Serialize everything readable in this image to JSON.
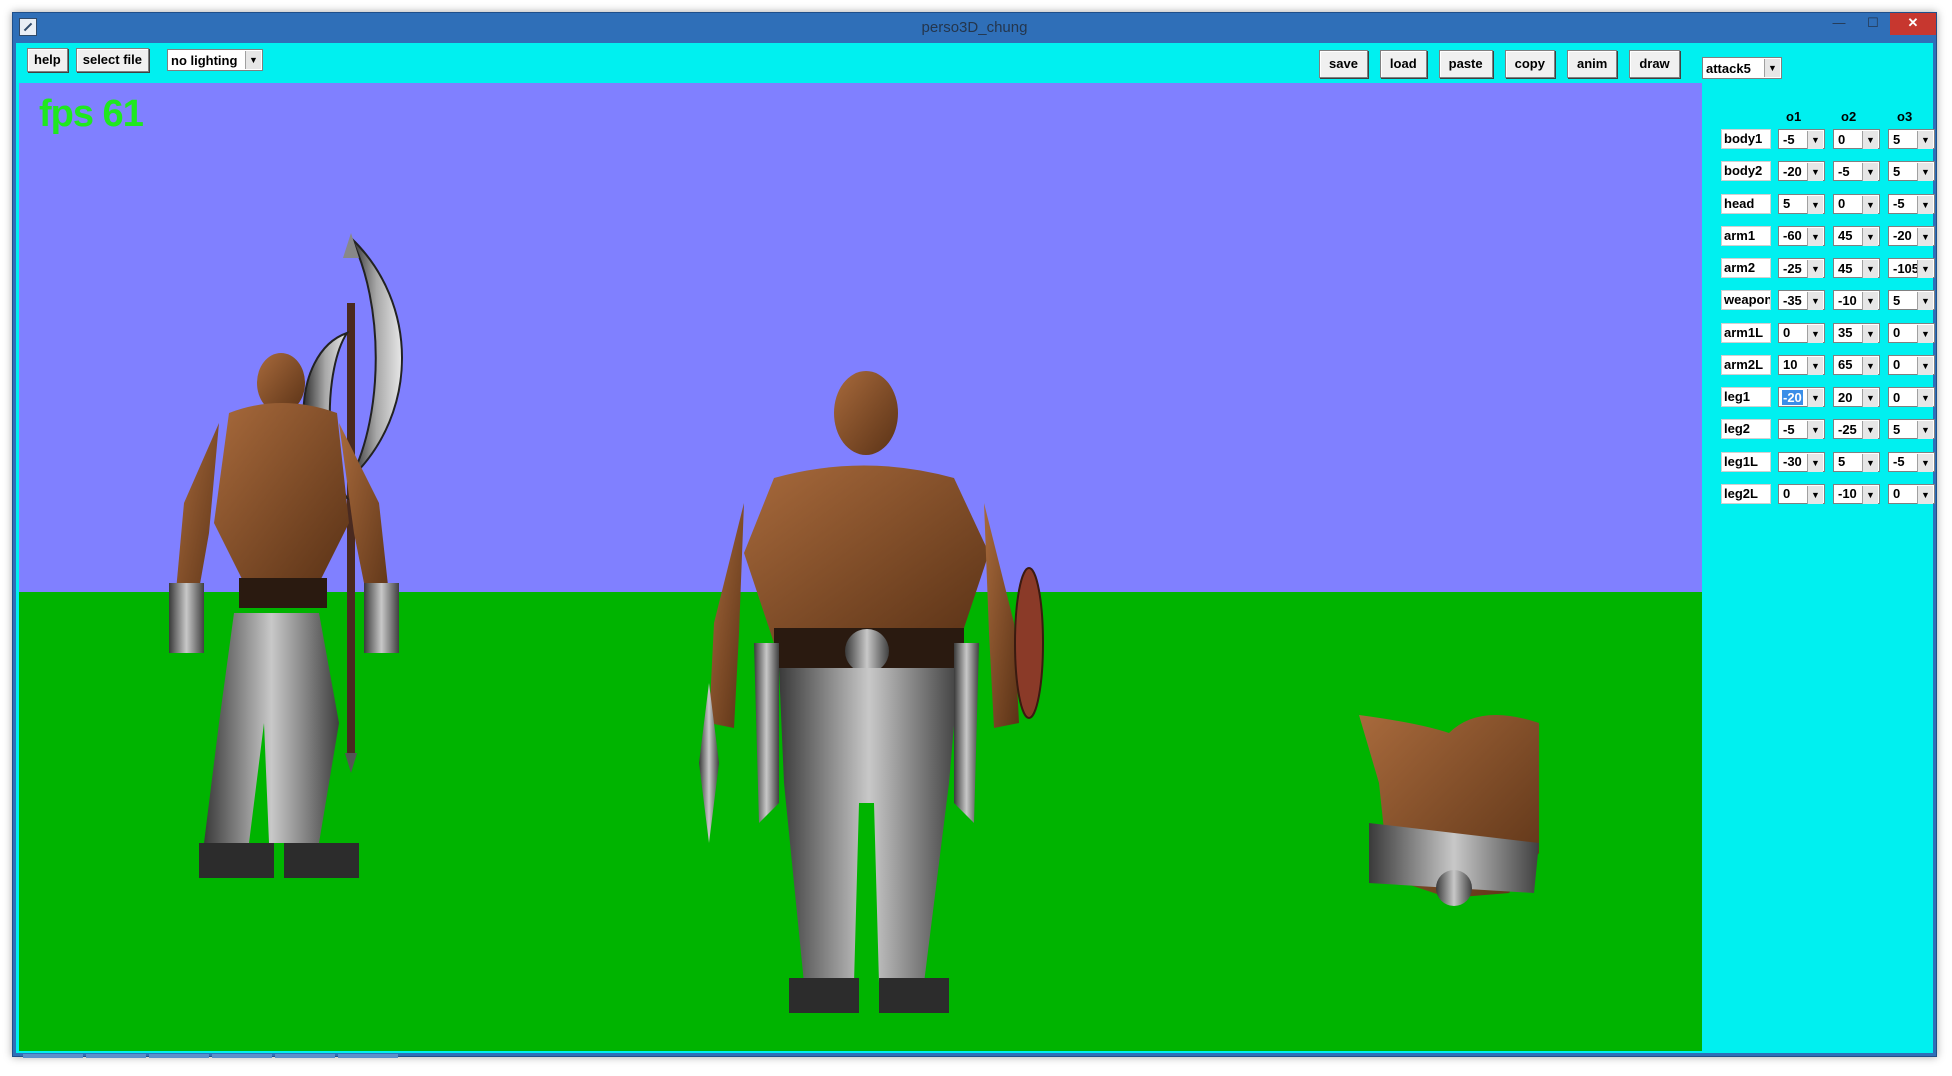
{
  "window": {
    "title": "perso3D_chung",
    "min_glyph": "—",
    "max_glyph": "☐",
    "close_glyph": "✕"
  },
  "toolbar_left": {
    "help_label": "help",
    "select_file_label": "select file",
    "lighting_value": "no lighting"
  },
  "toolbar_right": {
    "save_label": "save",
    "load_label": "load",
    "paste_label": "paste",
    "copy_label": "copy",
    "anim_label": "anim",
    "draw_label": "draw"
  },
  "viewport": {
    "fps_text": "fps 61",
    "sky_color": "#8080ff",
    "ground_color": "#00b400"
  },
  "panel": {
    "animation_value": "attack5",
    "col_headers": [
      "o1",
      "o2",
      "o3"
    ],
    "rows": [
      {
        "label": "body1",
        "v": [
          "-5",
          "0",
          "5"
        ]
      },
      {
        "label": "body2",
        "v": [
          "-20",
          "-5",
          "5"
        ]
      },
      {
        "label": "head",
        "v": [
          "5",
          "0",
          "-5"
        ]
      },
      {
        "label": "arm1",
        "v": [
          "-60",
          "45",
          "-20"
        ]
      },
      {
        "label": "arm2",
        "v": [
          "-25",
          "45",
          "-105"
        ]
      },
      {
        "label": "weapon",
        "v": [
          "-35",
          "-10",
          "5"
        ]
      },
      {
        "label": "arm1L",
        "v": [
          "0",
          "35",
          "0"
        ]
      },
      {
        "label": "arm2L",
        "v": [
          "10",
          "65",
          "0"
        ]
      },
      {
        "label": "leg1",
        "v": [
          "-20",
          "20",
          "0"
        ]
      },
      {
        "label": "leg2",
        "v": [
          "-5",
          "-25",
          "5"
        ]
      },
      {
        "label": "leg1L",
        "v": [
          "-30",
          "5",
          "-5"
        ]
      },
      {
        "label": "leg2L",
        "v": [
          "0",
          "-10",
          "0"
        ]
      }
    ]
  },
  "colors": {
    "client_bg": "#00f0f0",
    "highlight": "#3a8ee8"
  }
}
